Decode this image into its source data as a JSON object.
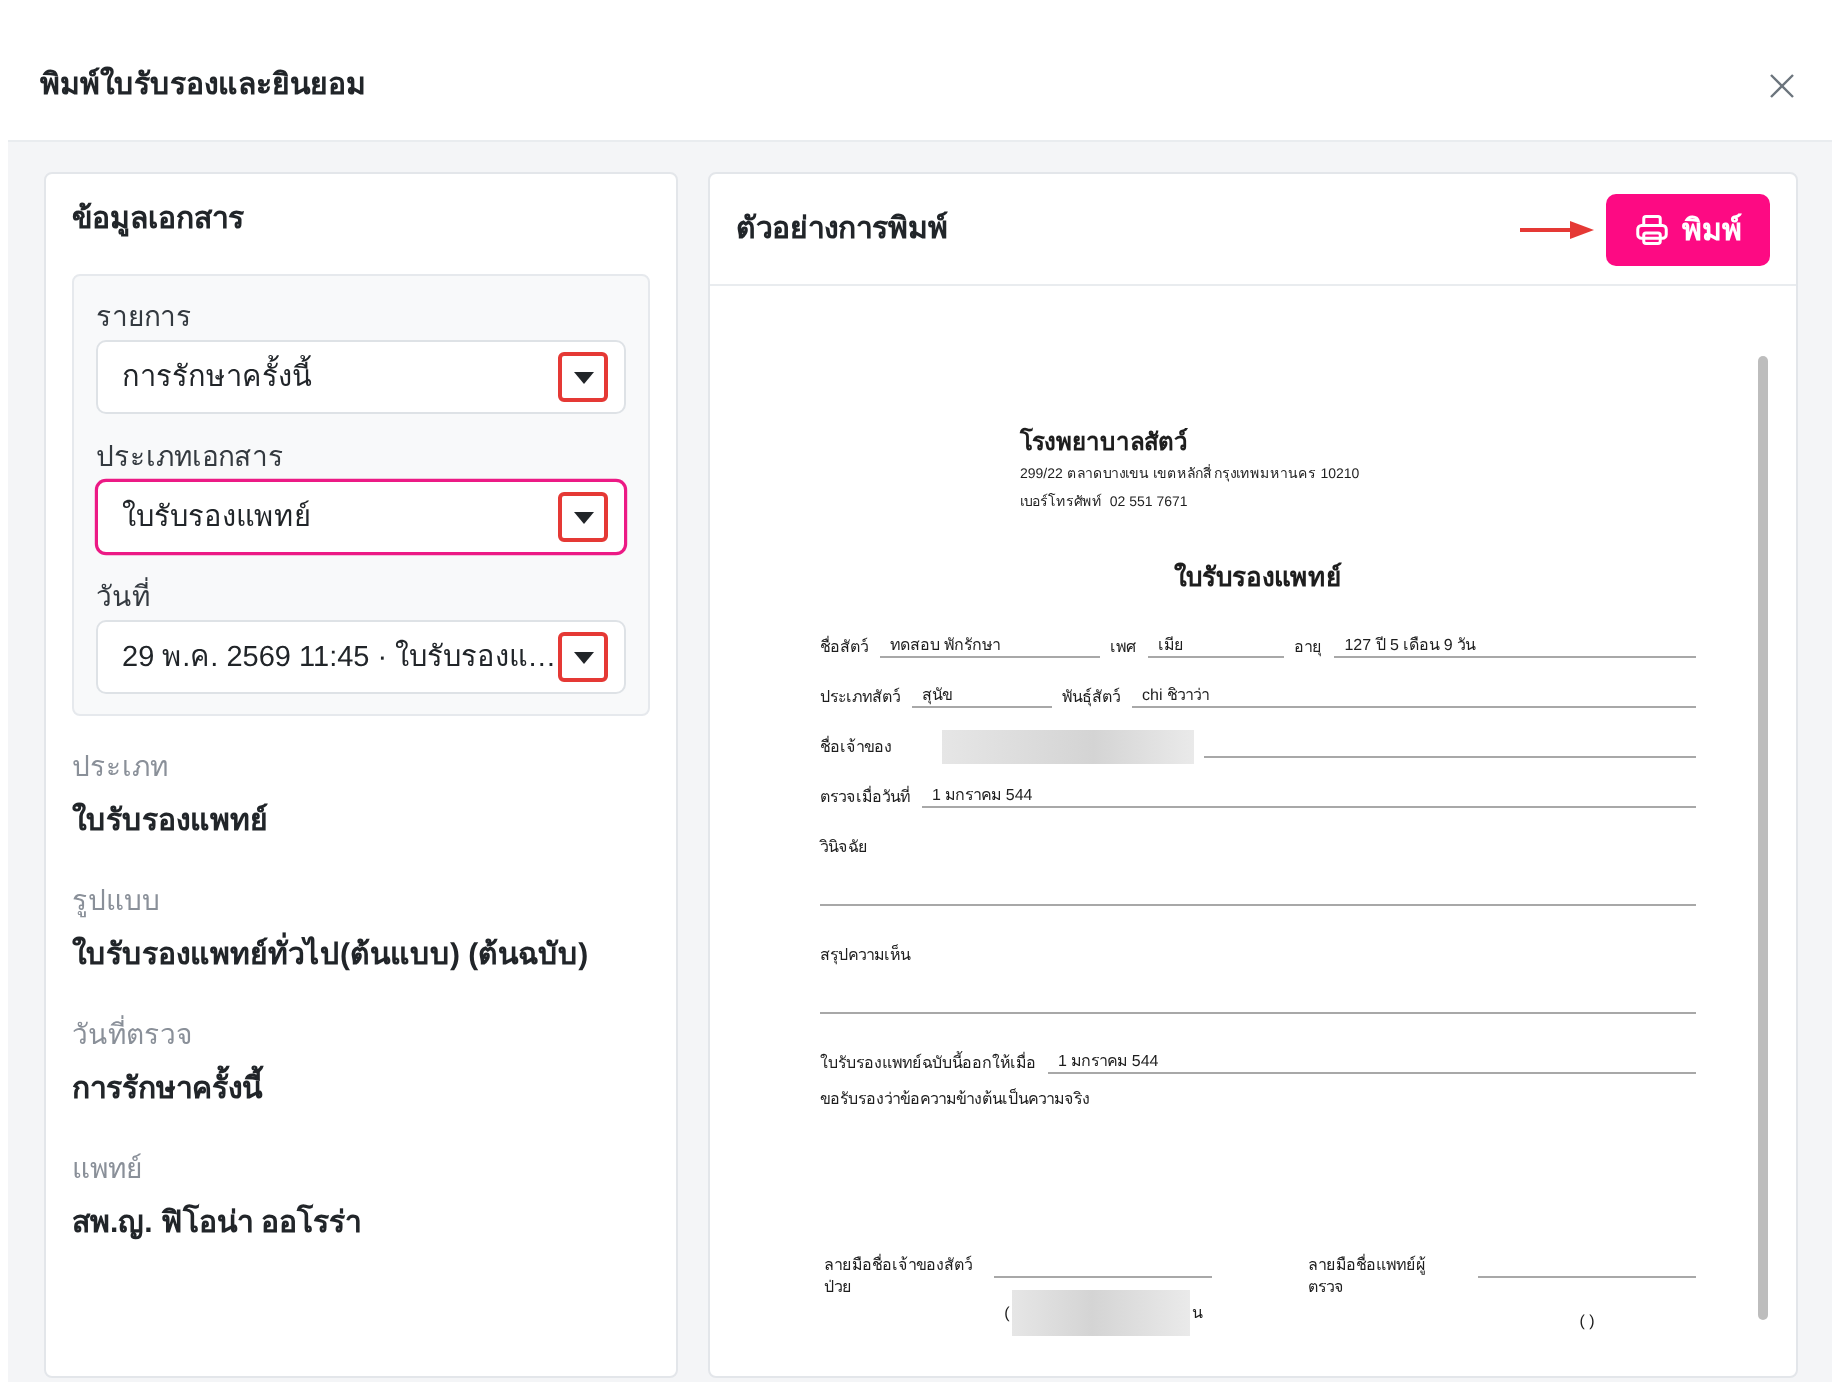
{
  "dialog": {
    "title": "พิมพ์ใบรับรองและยินยอม"
  },
  "document_info": {
    "title": "ข้อมูลเอกสาร",
    "fields": [
      {
        "label": "รายการ",
        "value": "การรักษาครั้งนี้",
        "focused": false,
        "highlighted": true
      },
      {
        "label": "ประเภทเอกสาร",
        "value": "ใบรับรองแพทย์",
        "focused": true,
        "highlighted": true
      },
      {
        "label": "วันที่",
        "value": "29 พ.ค. 2569 11:45 · ใบรับรองแ…",
        "focused": false,
        "highlighted": true
      }
    ],
    "details": [
      {
        "label": "ประเภท",
        "value": "ใบรับรองแพทย์"
      },
      {
        "label": "รูปแบบ",
        "value": "ใบรับรองแพทย์ทั่วไป(ต้นแบบ) (ต้นฉบับ)"
      },
      {
        "label": "วันที่ตรวจ",
        "value": "การรักษาครั้งนี้"
      },
      {
        "label": "แพทย์",
        "value": "สพ.ญ. ฟิโอน่า ออโรร่า"
      }
    ]
  },
  "preview": {
    "title": "ตัวอย่างการพิมพ์",
    "print_button": {
      "label": "พิมพ์",
      "highlighted": true
    },
    "document": {
      "clinic_name": "โรงพยาบาลสัตว์",
      "address": "299/22 ตลาดบางเขน เขตหลักสี่ กรุงเทพมหานคร 10210",
      "phone": "เบอร์โทรศัพท์  02 551 7671",
      "title": "ใบรับรองแพทย์",
      "lines": [
        {
          "kind": "fields",
          "items": [
            {
              "label": "ชื่อสัตว์",
              "value": "ทดสอบ พักรักษา"
            },
            {
              "label": "เพศ",
              "value": "เมีย"
            },
            {
              "label": "อายุ",
              "value": "127 ปี 5 เดือน 9 วัน"
            }
          ]
        },
        {
          "kind": "fields",
          "items": [
            {
              "label": "ประเภทสัตว์",
              "value": "สุนัข"
            },
            {
              "label": "พันธุ์สัตว์",
              "value": "chi ชิวาว่า"
            }
          ]
        },
        {
          "kind": "fields",
          "items": [
            {
              "label": "ชื่อเจ้าของ",
              "redacted": true
            }
          ]
        },
        {
          "kind": "fields",
          "items": [
            {
              "label": "ตรวจเมื่อวันที่",
              "value": "1 มกราคม 544"
            }
          ]
        },
        {
          "kind": "section",
          "label": "วินิจฉัย"
        },
        {
          "kind": "section",
          "label": "สรุปความเห็น"
        },
        {
          "kind": "fields",
          "items": [
            {
              "label": "ใบรับรองแพทย์ฉบับนี้ออกให้เมื่อ",
              "value": "1 มกราคม 544"
            }
          ]
        },
        {
          "kind": "text",
          "text": "ขอรับรองว่าข้อความข้างต้นเป็นความจริง"
        }
      ],
      "signatures": [
        {
          "label": "ลายมือชื่อเจ้าของสัตว์ป่วย",
          "name_parts": [
            "(",
            "น"
          ],
          "redacted": true
        },
        {
          "label": "ลายมือชื่อแพทย์ผู้ตรวจ",
          "name_parts": [
            "( )"
          ],
          "redacted": false
        }
      ]
    }
  }
}
